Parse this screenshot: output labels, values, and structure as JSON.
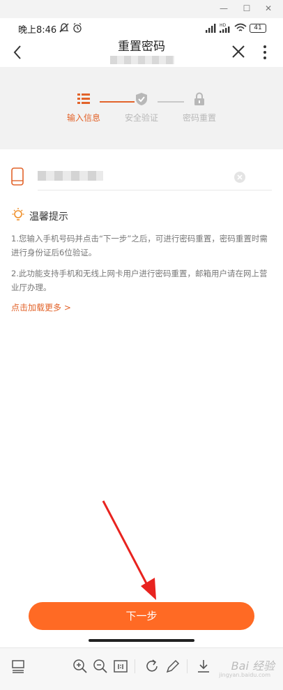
{
  "colors": {
    "accent": "#ff6a24",
    "accent_text": "#e2632a",
    "step_inactive": "#b8b8b8",
    "tip_text": "#777777"
  },
  "status": {
    "time": "晚上8:46",
    "battery": "41",
    "network": "HD"
  },
  "header": {
    "title": "重置密码"
  },
  "steps": [
    {
      "label": "输入信息",
      "icon": "list-icon",
      "active": true
    },
    {
      "label": "安全验证",
      "icon": "shield-check-icon",
      "active": false
    },
    {
      "label": "密码重置",
      "icon": "lock-icon",
      "active": false
    }
  ],
  "tips": {
    "title": "温馨提示",
    "items": [
      "1.您输入手机号码并点击“下一步”之后，可进行密码重置，密码重置时需进行身份证后6位验证。",
      "2.此功能支持手机和无线上网卡用户进行密码重置，邮箱用户请在网上营业厅办理。"
    ],
    "more": "点击加载更多 >"
  },
  "next_button": {
    "label": "下一步"
  },
  "watermark": {
    "text": "Bai 经验",
    "sub": "jingyan.baidu.com"
  }
}
